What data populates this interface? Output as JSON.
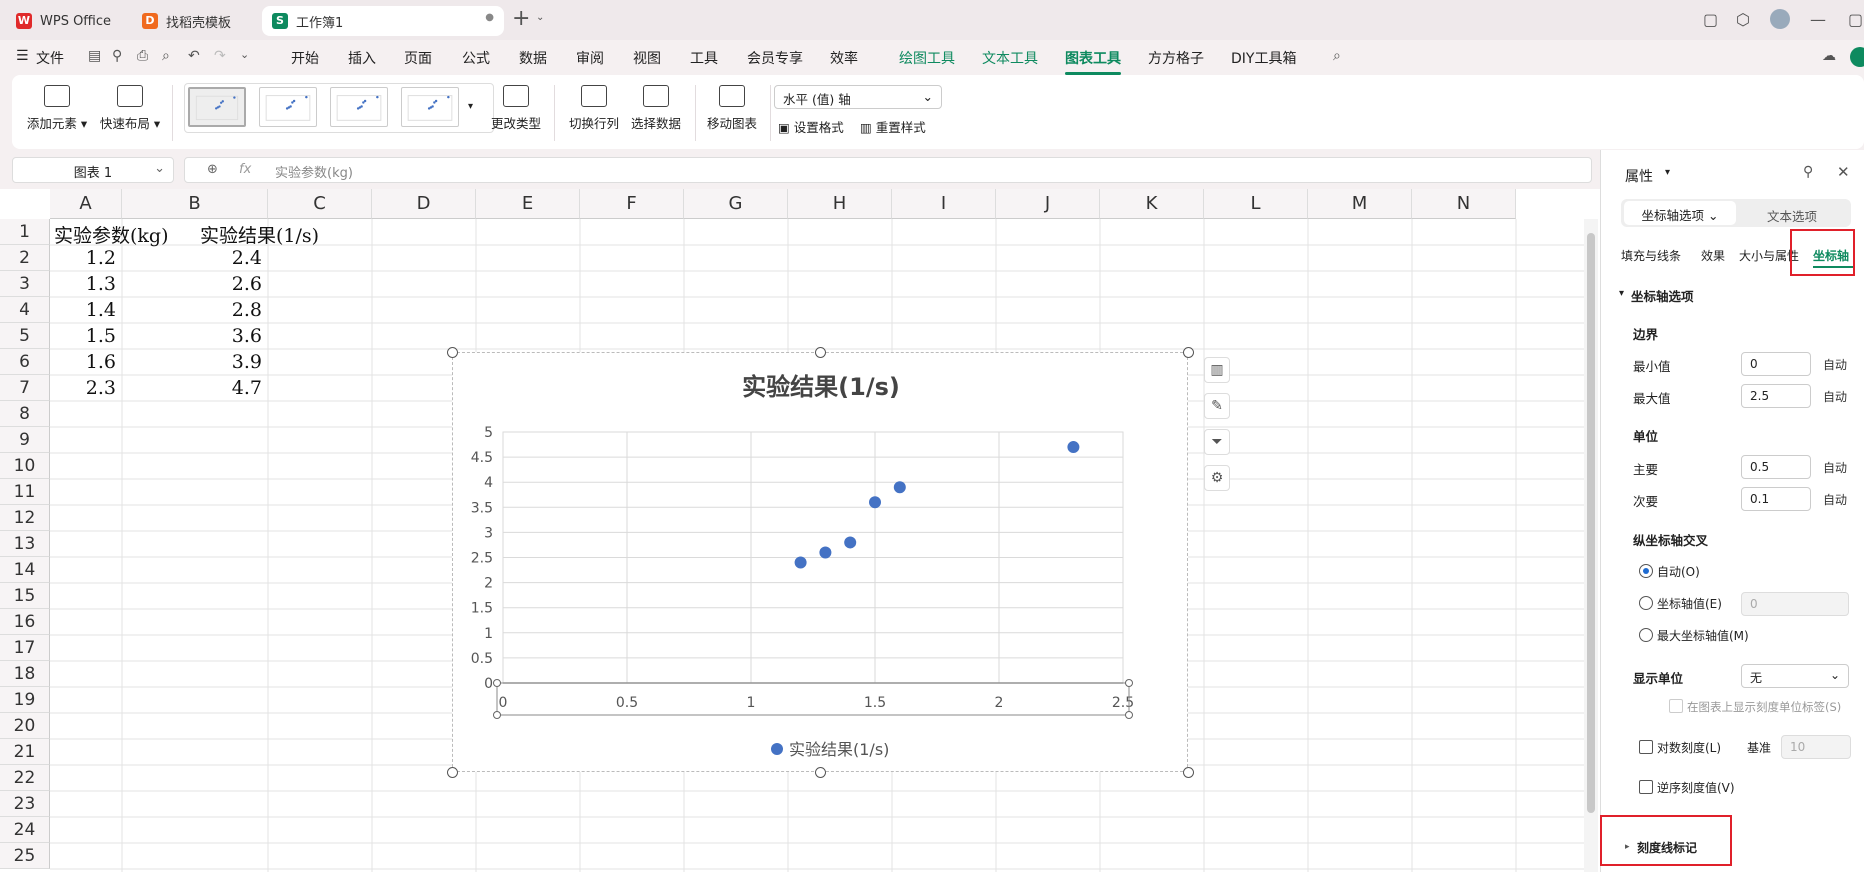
{
  "tabs": [
    {
      "label": "WPS Office",
      "icon": "wps-logo-icon"
    },
    {
      "label": "找稻壳模板",
      "icon": "docer-icon"
    },
    {
      "label": "工作簿1",
      "icon": "sheet-icon"
    }
  ],
  "menu": {
    "file": "文件",
    "items": [
      "开始",
      "插入",
      "页面",
      "公式",
      "数据",
      "审阅",
      "视图",
      "工具",
      "会员专享",
      "效率"
    ],
    "context_items": [
      "绘图工具",
      "文本工具",
      "图表工具",
      "方方格子",
      "DIY工具箱"
    ],
    "active": "图表工具"
  },
  "ribbon": {
    "add_element": "添加元素",
    "quick_layout": "快速布局",
    "change_type": "更改类型",
    "switch_rowcol": "切换行列",
    "select_data": "选择数据",
    "move_chart": "移动图表",
    "element_select": "水平 (值) 轴",
    "set_format": "设置格式",
    "reset_style": "重置样式"
  },
  "formula_bar": {
    "name_box": "图表 1",
    "fx": "fx",
    "content": "实验参数(kg)"
  },
  "sheet": {
    "columns": [
      "A",
      "B",
      "C",
      "D",
      "E",
      "F",
      "G",
      "H",
      "I",
      "J",
      "K",
      "L",
      "M",
      "N"
    ],
    "rows": [
      "1",
      "2",
      "3",
      "4",
      "5",
      "6",
      "7",
      "8",
      "9",
      "10",
      "11",
      "12",
      "13",
      "14",
      "15",
      "16",
      "17",
      "18",
      "19",
      "20",
      "21",
      "22",
      "23",
      "24",
      "25"
    ],
    "header_a": "实验参数(kg)",
    "header_b": "实验结果(1/s)",
    "data_a": [
      "1.2",
      "1.3",
      "1.4",
      "1.5",
      "1.6",
      "2.3"
    ],
    "data_b": [
      "2.4",
      "2.6",
      "2.8",
      "3.6",
      "3.9",
      "4.7"
    ]
  },
  "chart_data": {
    "type": "scatter",
    "title": "实验结果(1/s)",
    "series": [
      {
        "name": "实验结果(1/s)",
        "x": [
          1.2,
          1.3,
          1.4,
          1.5,
          1.6,
          2.3
        ],
        "y": [
          2.4,
          2.6,
          2.8,
          3.6,
          3.9,
          4.7
        ],
        "color": "#4472c4"
      }
    ],
    "xlim": [
      0,
      2.5
    ],
    "ylim": [
      0,
      5
    ],
    "x_ticks": [
      "0",
      "0.5",
      "1",
      "1.5",
      "2",
      "2.5"
    ],
    "y_ticks": [
      "0",
      "0.5",
      "1",
      "1.5",
      "2",
      "2.5",
      "3",
      "3.5",
      "4",
      "4.5",
      "5"
    ],
    "grid": true,
    "legend": "bottom"
  },
  "panel": {
    "title": "属性",
    "tab_axis_options": "坐标轴选项",
    "tab_text_options": "文本选项",
    "subtabs": [
      "填充与线条",
      "效果",
      "大小与属性",
      "坐标轴"
    ],
    "section": "坐标轴选项",
    "bounds_label": "边界",
    "min_label": "最小值",
    "min_value": "0",
    "max_label": "最大值",
    "max_value": "2.5",
    "units_label": "单位",
    "major_label": "主要",
    "major_value": "0.5",
    "minor_label": "次要",
    "minor_value": "0.1",
    "auto": "自动",
    "cross_label": "纵坐标轴交叉",
    "cross_auto": "自动(O)",
    "cross_value": "坐标轴值(E)",
    "cross_value_input": "0",
    "cross_max": "最大坐标轴值(M)",
    "display_units_label": "显示单位",
    "display_units_value": "无",
    "show_units_label": "在图表上显示刻度单位标签(S)",
    "log_scale": "对数刻度(L)",
    "base_label": "基准",
    "base_value": "10",
    "reverse": "逆序刻度值(V)",
    "tick_marks": "刻度线标记"
  },
  "accent_color": "#0e8a5f",
  "highlight_color": "#e0202a"
}
